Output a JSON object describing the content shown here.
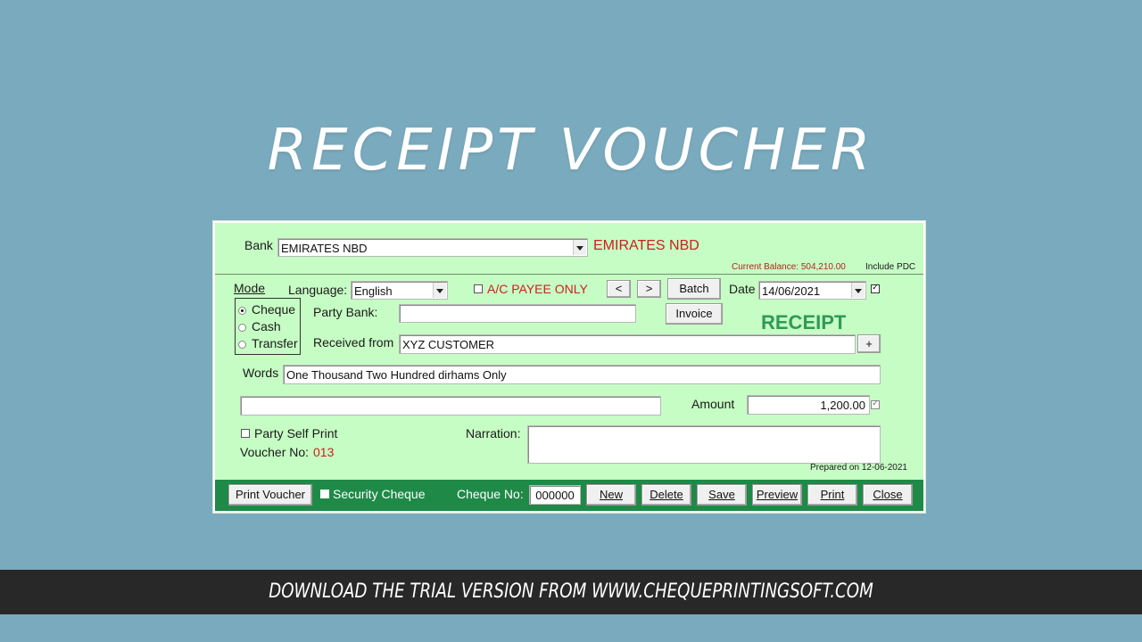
{
  "headline": "RECEIPT VOUCHER",
  "bank": {
    "label": "Bank",
    "value": "EMIRATES NBD",
    "display_name": "EMIRATES NBD",
    "current_balance": "Current Balance: 504,210.00",
    "include_pdc": "Include PDC"
  },
  "mode": {
    "label": "Mode",
    "options": [
      "Cheque",
      "Cash",
      "Transfer"
    ],
    "selected": "Cheque"
  },
  "language": {
    "label": "Language:",
    "value": "English"
  },
  "ac_payee": "A/C PAYEE ONLY",
  "nav": {
    "prev": "<",
    "next": ">"
  },
  "batch_label": "Batch",
  "date": {
    "label": "Date",
    "value": "14/06/2021"
  },
  "party_bank": {
    "label": "Party Bank:",
    "value": ""
  },
  "invoice_label": "Invoice",
  "receipt_title": "RECEIPT",
  "received_from": {
    "label": "Received from",
    "value": "XYZ CUSTOMER",
    "add": "+"
  },
  "words": {
    "label": "Words",
    "value": "One Thousand Two Hundred dirhams Only",
    "line2": ""
  },
  "amount": {
    "label": "Amount",
    "value": "1,200.00"
  },
  "party_self_print": "Party Self Print",
  "voucher_no": {
    "label": "Voucher No:",
    "value": "013"
  },
  "narration": {
    "label": "Narration:",
    "value": ""
  },
  "prepared_on": "Prepared on 12-06-2021",
  "bottom": {
    "print_voucher": "Print Voucher",
    "security_cheque": "Security Cheque",
    "cheque_no_label": "Cheque No:",
    "cheque_no_value": "000000",
    "new": "New",
    "delete": "Delete",
    "save": "Save",
    "preview": "Preview",
    "print": "Print",
    "close": "Close"
  },
  "footer": "DOWNLOAD THE TRIAL VERSION FROM WWW.CHEQUEPRINTINGSOFT.COM",
  "colors": {
    "background": "#7aaabd",
    "window": "#c6fdc4",
    "bottombar": "#1f8a48",
    "accent_red": "#cc1f1f",
    "receipt_green": "#2f9a55"
  }
}
